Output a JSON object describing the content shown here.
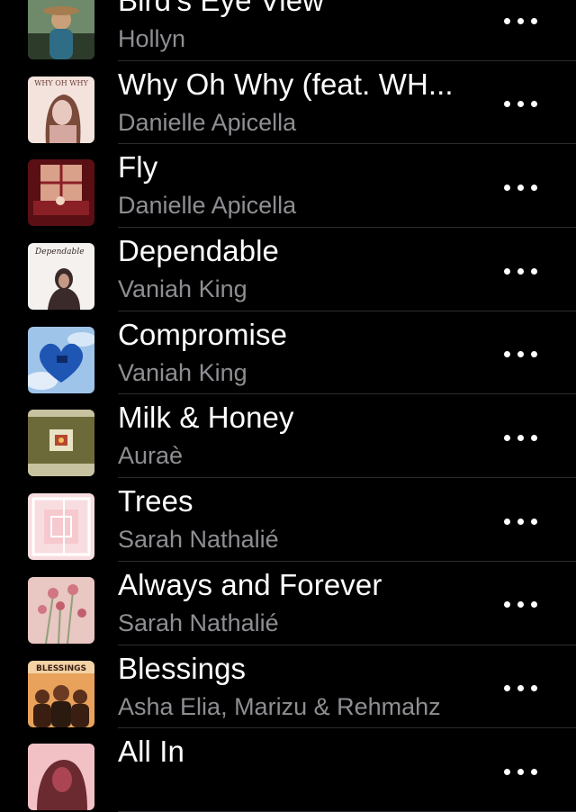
{
  "songs": [
    {
      "title": "Bird's Eye View",
      "artist": "Hollyn",
      "art": "bird-eye-view-artwork",
      "colors": [
        "#6f8a6a",
        "#c9a07a",
        "#2d3b2a"
      ]
    },
    {
      "title": "Why Oh Why (feat. WH...",
      "artist": "Danielle Apicella",
      "art": "why-oh-why-artwork",
      "colors": [
        "#e8c9c0",
        "#7a4a3a",
        "#f3e3dc"
      ],
      "art_text": "WHY OH WHY"
    },
    {
      "title": "Fly",
      "artist": "Danielle Apicella",
      "art": "fly-artwork",
      "colors": [
        "#8a1f26",
        "#d9a08a",
        "#5a0f14"
      ]
    },
    {
      "title": "Dependable",
      "artist": "Vaniah King",
      "art": "dependable-artwork",
      "colors": [
        "#f4f1ef",
        "#3a2a2a",
        "#d8c8c6"
      ],
      "art_text": "Dependable"
    },
    {
      "title": "Compromise",
      "artist": "Vaniah King",
      "art": "compromise-artwork",
      "colors": [
        "#9fc4ea",
        "#1f56b4",
        "#ffffff"
      ]
    },
    {
      "title": "Milk & Honey",
      "artist": "Auraè",
      "art": "milk-honey-artwork",
      "colors": [
        "#6d6a3a",
        "#c7c3a0",
        "#b7462f"
      ]
    },
    {
      "title": "Trees",
      "artist": "Sarah Nathalié",
      "art": "trees-artwork",
      "colors": [
        "#f6c9cf",
        "#f8dde0",
        "#ffffff"
      ]
    },
    {
      "title": "Always and Forever",
      "artist": "Sarah Nathalié",
      "art": "always-forever-artwork",
      "colors": [
        "#e9c7c2",
        "#d07783",
        "#8fa07a"
      ]
    },
    {
      "title": "Blessings",
      "artist": "Asha Elia, Marizu & Rehmahz",
      "art": "blessings-artwork",
      "colors": [
        "#e9a25b",
        "#5a2f1c",
        "#f3d3a6"
      ],
      "art_text": "BLESSINGS"
    },
    {
      "title": "All In",
      "artist": "",
      "art": "all-in-artwork",
      "colors": [
        "#d9586b",
        "#f1c1c6",
        "#6a2a30"
      ]
    }
  ],
  "more_icon": "ellipsis-more-icon"
}
